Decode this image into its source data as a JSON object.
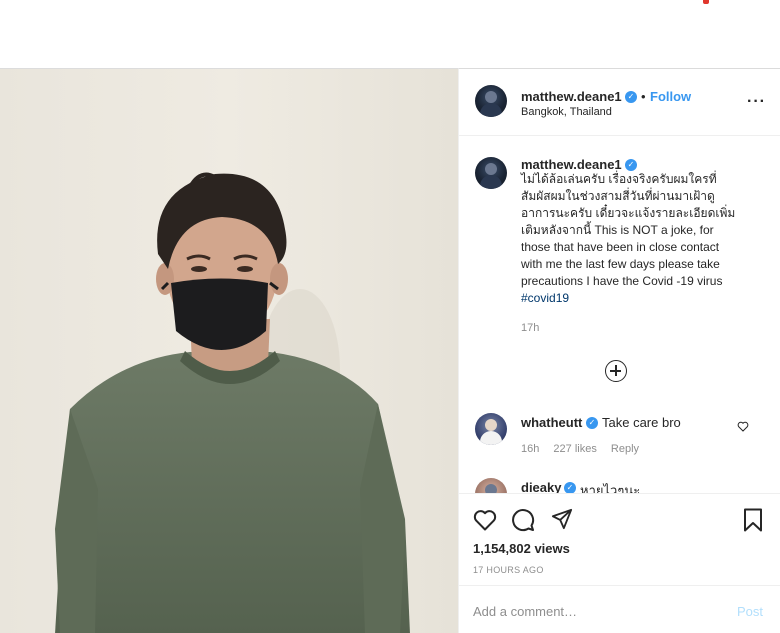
{
  "post_header": {
    "username": "matthew.deane1",
    "follow_label": "Follow",
    "separator": "•",
    "location": "Bangkok, Thailand",
    "more_icon": "more-options-icon"
  },
  "caption": {
    "username": "matthew.deane1",
    "lines": [
      "ไม่ได้ล้อเล่นครับ เรื่องจริงครับผมใครที่",
      "สัมผัสผมในช่วงสามสี่วันที่ผ่านมาเฝ้าดู",
      "อาการนะครับ เดี๋ยวจะแจ้งรายละเอียดเพิ่ม",
      "เติมหลังจากนี้ This is NOT a joke, for",
      "those that have been in close contact",
      "with me the last few days please take",
      "precautions I have the Covid -19 virus"
    ],
    "hashtag": "#covid19",
    "time": "17h"
  },
  "comments": [
    {
      "username": "whatheutt",
      "text": "Take care bro",
      "time": "16h",
      "likes": "227 likes",
      "reply_label": "Reply"
    },
    {
      "username": "dieaky",
      "text": "หายไวๆนะ"
    }
  ],
  "actions": {
    "icons": [
      "heart-icon",
      "comment-icon",
      "share-icon",
      "bookmark-icon"
    ]
  },
  "stats": {
    "views": "1,154,802 views",
    "posted": "17 HOURS AGO"
  },
  "comment_box": {
    "placeholder": "Add a comment…",
    "post_label": "Post"
  },
  "colors": {
    "accent_blue": "#3897f0",
    "text": "#262626",
    "muted": "#8e8e8e",
    "hashtag": "#00376b"
  }
}
